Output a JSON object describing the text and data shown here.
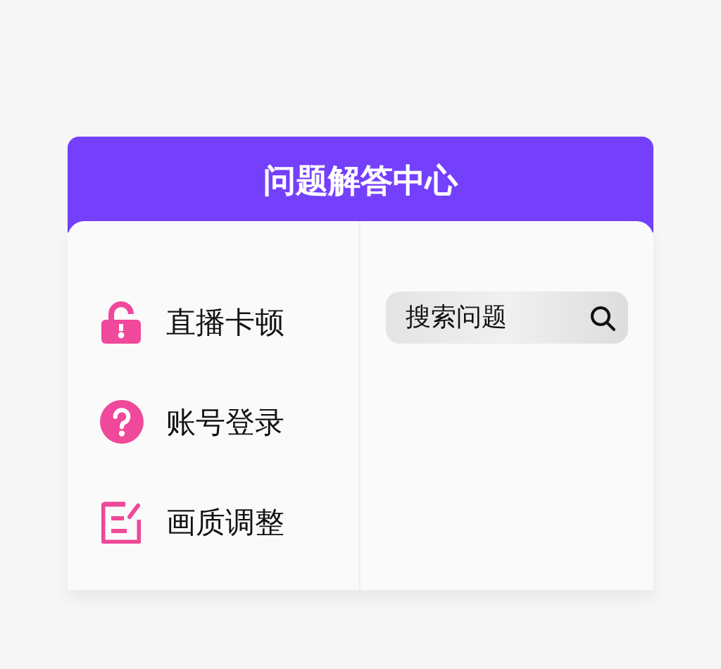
{
  "header": {
    "title": "问题解答中心"
  },
  "menu": [
    {
      "kind": "lock",
      "label": "直播卡顿"
    },
    {
      "kind": "question",
      "label": "账号登录"
    },
    {
      "kind": "edit",
      "label": "画质调整"
    }
  ],
  "search": {
    "placeholder": "搜索问题"
  }
}
